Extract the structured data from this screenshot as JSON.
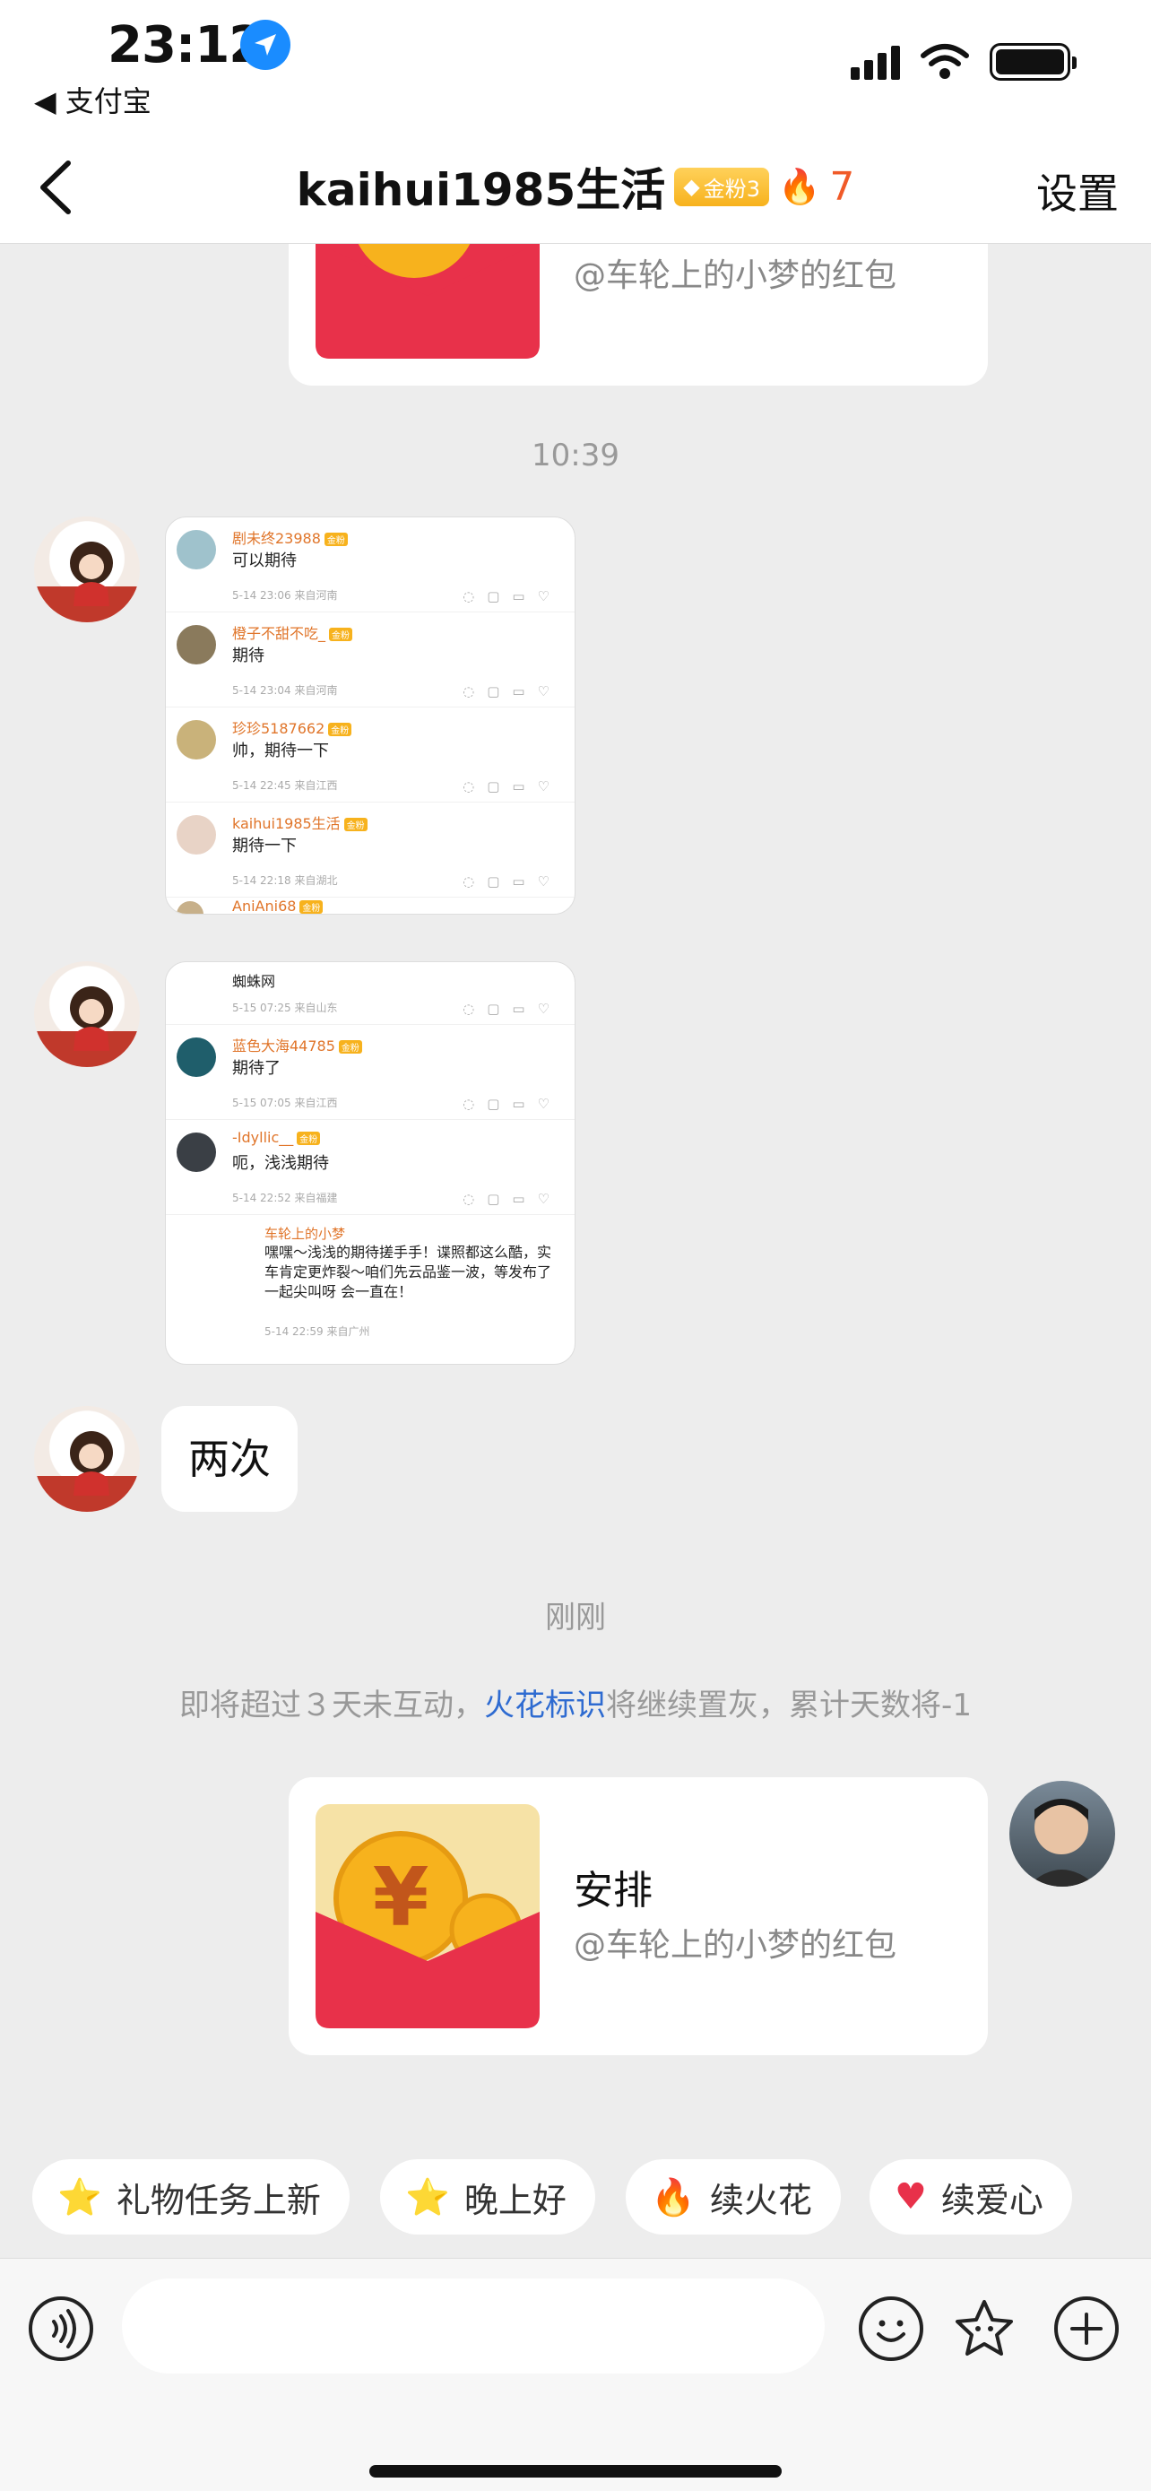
{
  "status": {
    "time": "23:12",
    "back_app": "◀ 支付宝"
  },
  "nav": {
    "title": "kaihui1985生活",
    "fan_badge": "金粉3",
    "fire_count": "7",
    "settings": "设置"
  },
  "messages": {
    "top_card_subtitle": "@车轮上的小梦的红包",
    "time_1": "10:39",
    "shot1": {
      "comments": [
        {
          "name": "剧未终23988",
          "text": "可以期待",
          "meta": "5-14 23:06  来自河南"
        },
        {
          "name": "橙子不甜不吃_",
          "text": "期待",
          "meta": "5-14 23:04  来自河南"
        },
        {
          "name": "珍珍5187662",
          "text": "帅，期待一下",
          "meta": "5-14 22:45  来自江西"
        },
        {
          "name": "kaihui1985生活",
          "text": "期待一下",
          "meta": "5-14 22:18  来自湖北"
        }
      ],
      "last_name": "AniAni68"
    },
    "shot2": {
      "comments": [
        {
          "name": "蜘蛛网",
          "text": "",
          "meta": "5-15 07:25  来自山东"
        },
        {
          "name": "蓝色大海44785",
          "text": "期待了",
          "meta": "5-15 07:05  来自江西"
        },
        {
          "name": "-Idyllic__",
          "text": "呃，浅浅期待",
          "meta": "5-14 22:52  来自福建"
        }
      ],
      "reply": {
        "name": "车轮上的小梦",
        "text": "嘿嘿～浅浅的期待搓手手！谍照都这么酷，实车肯定更炸裂～咱们先云品鉴一波，等发布了一起尖叫呀 会一直在！",
        "meta": "5-14 22:59  来自广州"
      }
    },
    "text_bubble": "两次",
    "time_2": "刚刚",
    "notice_pre": "即将超过３天未互动，",
    "notice_link": "火花标识",
    "notice_post": "将继续置灰，累计天数将-1",
    "bottom_card_title": "安排",
    "bottom_card_subtitle": "@车轮上的小梦的红包"
  },
  "chips": [
    {
      "label": "礼物任务上新",
      "icon": "star-face-icon"
    },
    {
      "label": "晚上好",
      "icon": "star-face-icon"
    },
    {
      "label": "续火花",
      "icon": "fire-icon"
    },
    {
      "label": "续爱心",
      "icon": "heart-icon"
    }
  ],
  "colors": {
    "accent_link": "#2e6bd1",
    "fire": "#f05a28",
    "red_packet": "#e8314a",
    "gold": "#f7b21d"
  }
}
